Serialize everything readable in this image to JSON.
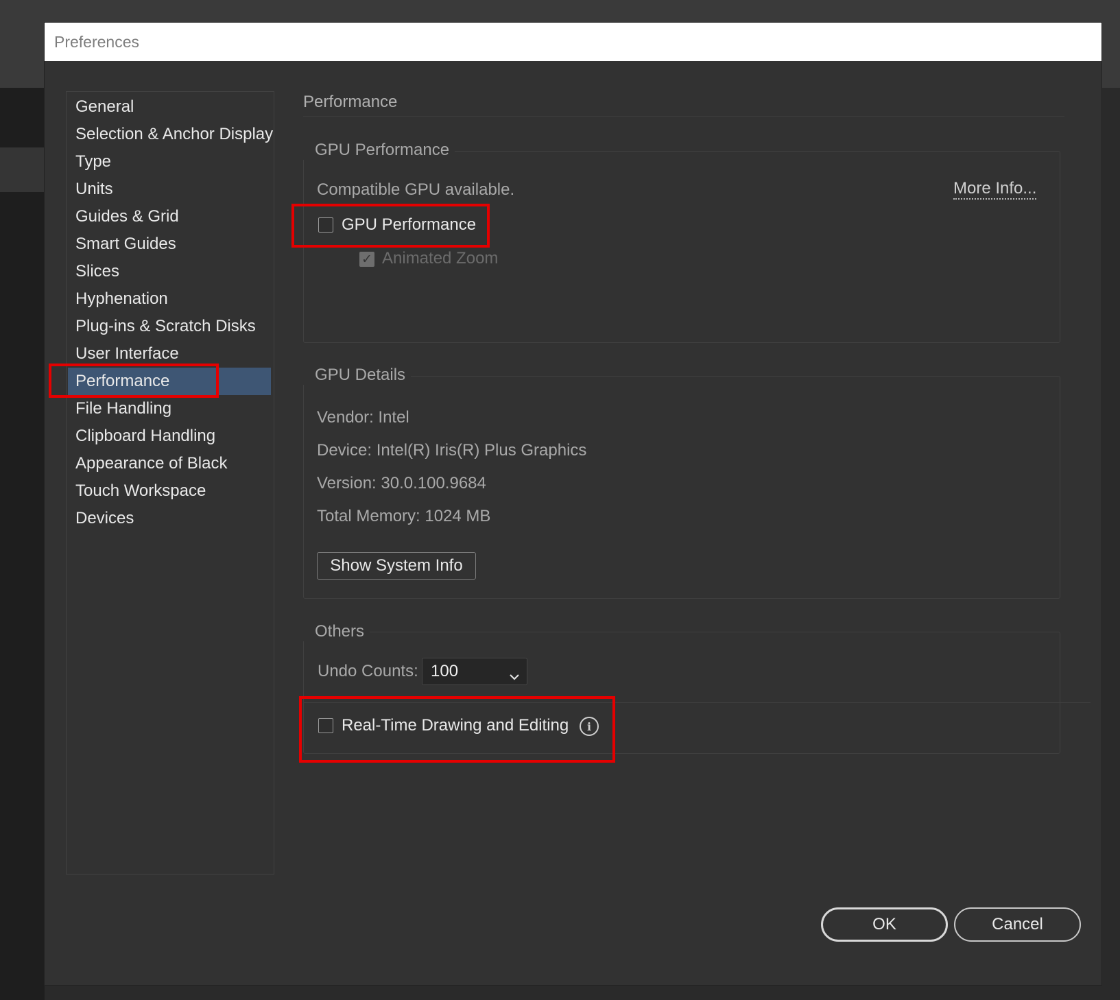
{
  "window": {
    "title": "Preferences"
  },
  "sidebar": {
    "items": [
      {
        "label": "General"
      },
      {
        "label": "Selection & Anchor Display"
      },
      {
        "label": "Type"
      },
      {
        "label": "Units"
      },
      {
        "label": "Guides & Grid"
      },
      {
        "label": "Smart Guides"
      },
      {
        "label": "Slices"
      },
      {
        "label": "Hyphenation"
      },
      {
        "label": "Plug-ins & Scratch Disks"
      },
      {
        "label": "User Interface"
      },
      {
        "label": "Performance",
        "selected": true
      },
      {
        "label": "File Handling"
      },
      {
        "label": "Clipboard Handling"
      },
      {
        "label": "Appearance of Black"
      },
      {
        "label": "Touch Workspace"
      },
      {
        "label": "Devices"
      }
    ]
  },
  "main": {
    "title": "Performance",
    "gpu_performance": {
      "legend": "GPU Performance",
      "status": "Compatible GPU available.",
      "more_info_label": "More Info...",
      "gpu_checkbox_label": "GPU Performance",
      "gpu_checked": false,
      "animated_zoom_label": "Animated Zoom",
      "animated_zoom_checked": true,
      "animated_zoom_enabled": false
    },
    "gpu_details": {
      "legend": "GPU Details",
      "vendor": "Vendor: Intel",
      "device": "Device: Intel(R) Iris(R) Plus Graphics",
      "version": "Version: 30.0.100.9684",
      "total_memory": "Total Memory: 1024 MB",
      "show_system_info_label": "Show System Info"
    },
    "others": {
      "legend": "Others",
      "undo_counts_label": "Undo Counts:",
      "undo_counts_value": "100",
      "realtime_label": "Real-Time Drawing and Editing",
      "realtime_checked": false,
      "info_icon": "info-icon"
    }
  },
  "footer": {
    "ok_label": "OK",
    "cancel_label": "Cancel"
  },
  "colors": {
    "dialog_bg": "#323232",
    "selection_bg": "#3e5674",
    "highlight_red": "#e50000"
  }
}
